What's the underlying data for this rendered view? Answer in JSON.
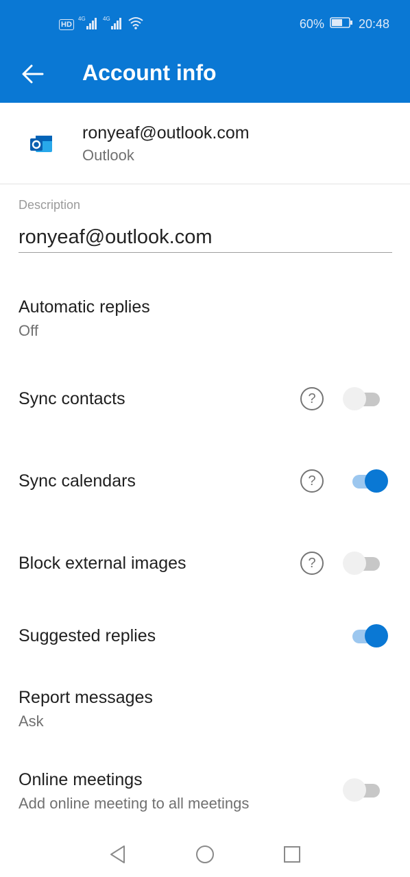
{
  "status_bar": {
    "left_icons": [
      "hd-icon",
      "signal-4g-icon",
      "signal-4g-icon",
      "wifi-icon"
    ],
    "network_label_1": "4G",
    "network_label_2": "4G",
    "hd_label": "HD",
    "battery_percent": "60%",
    "time": "20:48"
  },
  "toolbar": {
    "title": "Account info",
    "back_icon": "arrow-left-icon"
  },
  "account": {
    "email": "ronyeaf@outlook.com",
    "type": "Outlook",
    "logo_icon": "outlook-logo-icon"
  },
  "description": {
    "label": "Description",
    "value": "ronyeaf@outlook.com"
  },
  "settings": {
    "automatic_replies": {
      "title": "Automatic replies",
      "value": "Off"
    },
    "sync_contacts": {
      "title": "Sync contacts",
      "enabled": false
    },
    "sync_calendars": {
      "title": "Sync calendars",
      "enabled": true
    },
    "block_external_images": {
      "title": "Block external images",
      "enabled": false
    },
    "suggested_replies": {
      "title": "Suggested replies",
      "enabled": true
    },
    "report_messages": {
      "title": "Report messages",
      "value": "Ask"
    },
    "online_meetings": {
      "title": "Online meetings",
      "subtitle": "Add online meeting to all meetings",
      "enabled": false
    }
  },
  "help_glyph": "?",
  "colors": {
    "accent": "#0a78d4",
    "toggle_off_track": "#c7c7c7",
    "toggle_on_track": "#9cc7ef"
  },
  "nav": [
    "back-triangle-icon",
    "home-circle-icon",
    "recents-square-icon"
  ]
}
